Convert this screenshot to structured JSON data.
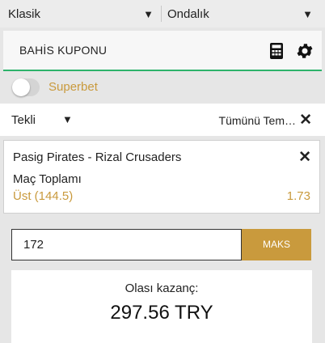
{
  "top_selectors": {
    "view": {
      "value": "Klasik",
      "icon": "caret-down-icon"
    },
    "odds_format": {
      "value": "Ondalık",
      "icon": "caret-down-icon"
    }
  },
  "coupon": {
    "title": "BAHİS KUPONU",
    "accent_color": "#2db36b",
    "icons": [
      "calculator-icon",
      "gear-icon"
    ]
  },
  "superbet": {
    "label": "Superbet",
    "enabled": false
  },
  "bet_type": {
    "value": "Tekli",
    "clear_all_label": "Tümünü Tem…"
  },
  "selections": [
    {
      "match": "Pasig Pirates - Rizal Crusaders",
      "market": "Maç Toplamı",
      "pick": "Üst (144.5)",
      "odds": "1.73"
    }
  ],
  "stake": {
    "value": "172",
    "max_label": "MAKS"
  },
  "winnings": {
    "label": "Olası kazanç:",
    "value": "297.56 TRY"
  },
  "colors": {
    "gold": "#c99a3d",
    "green": "#2db36b"
  }
}
